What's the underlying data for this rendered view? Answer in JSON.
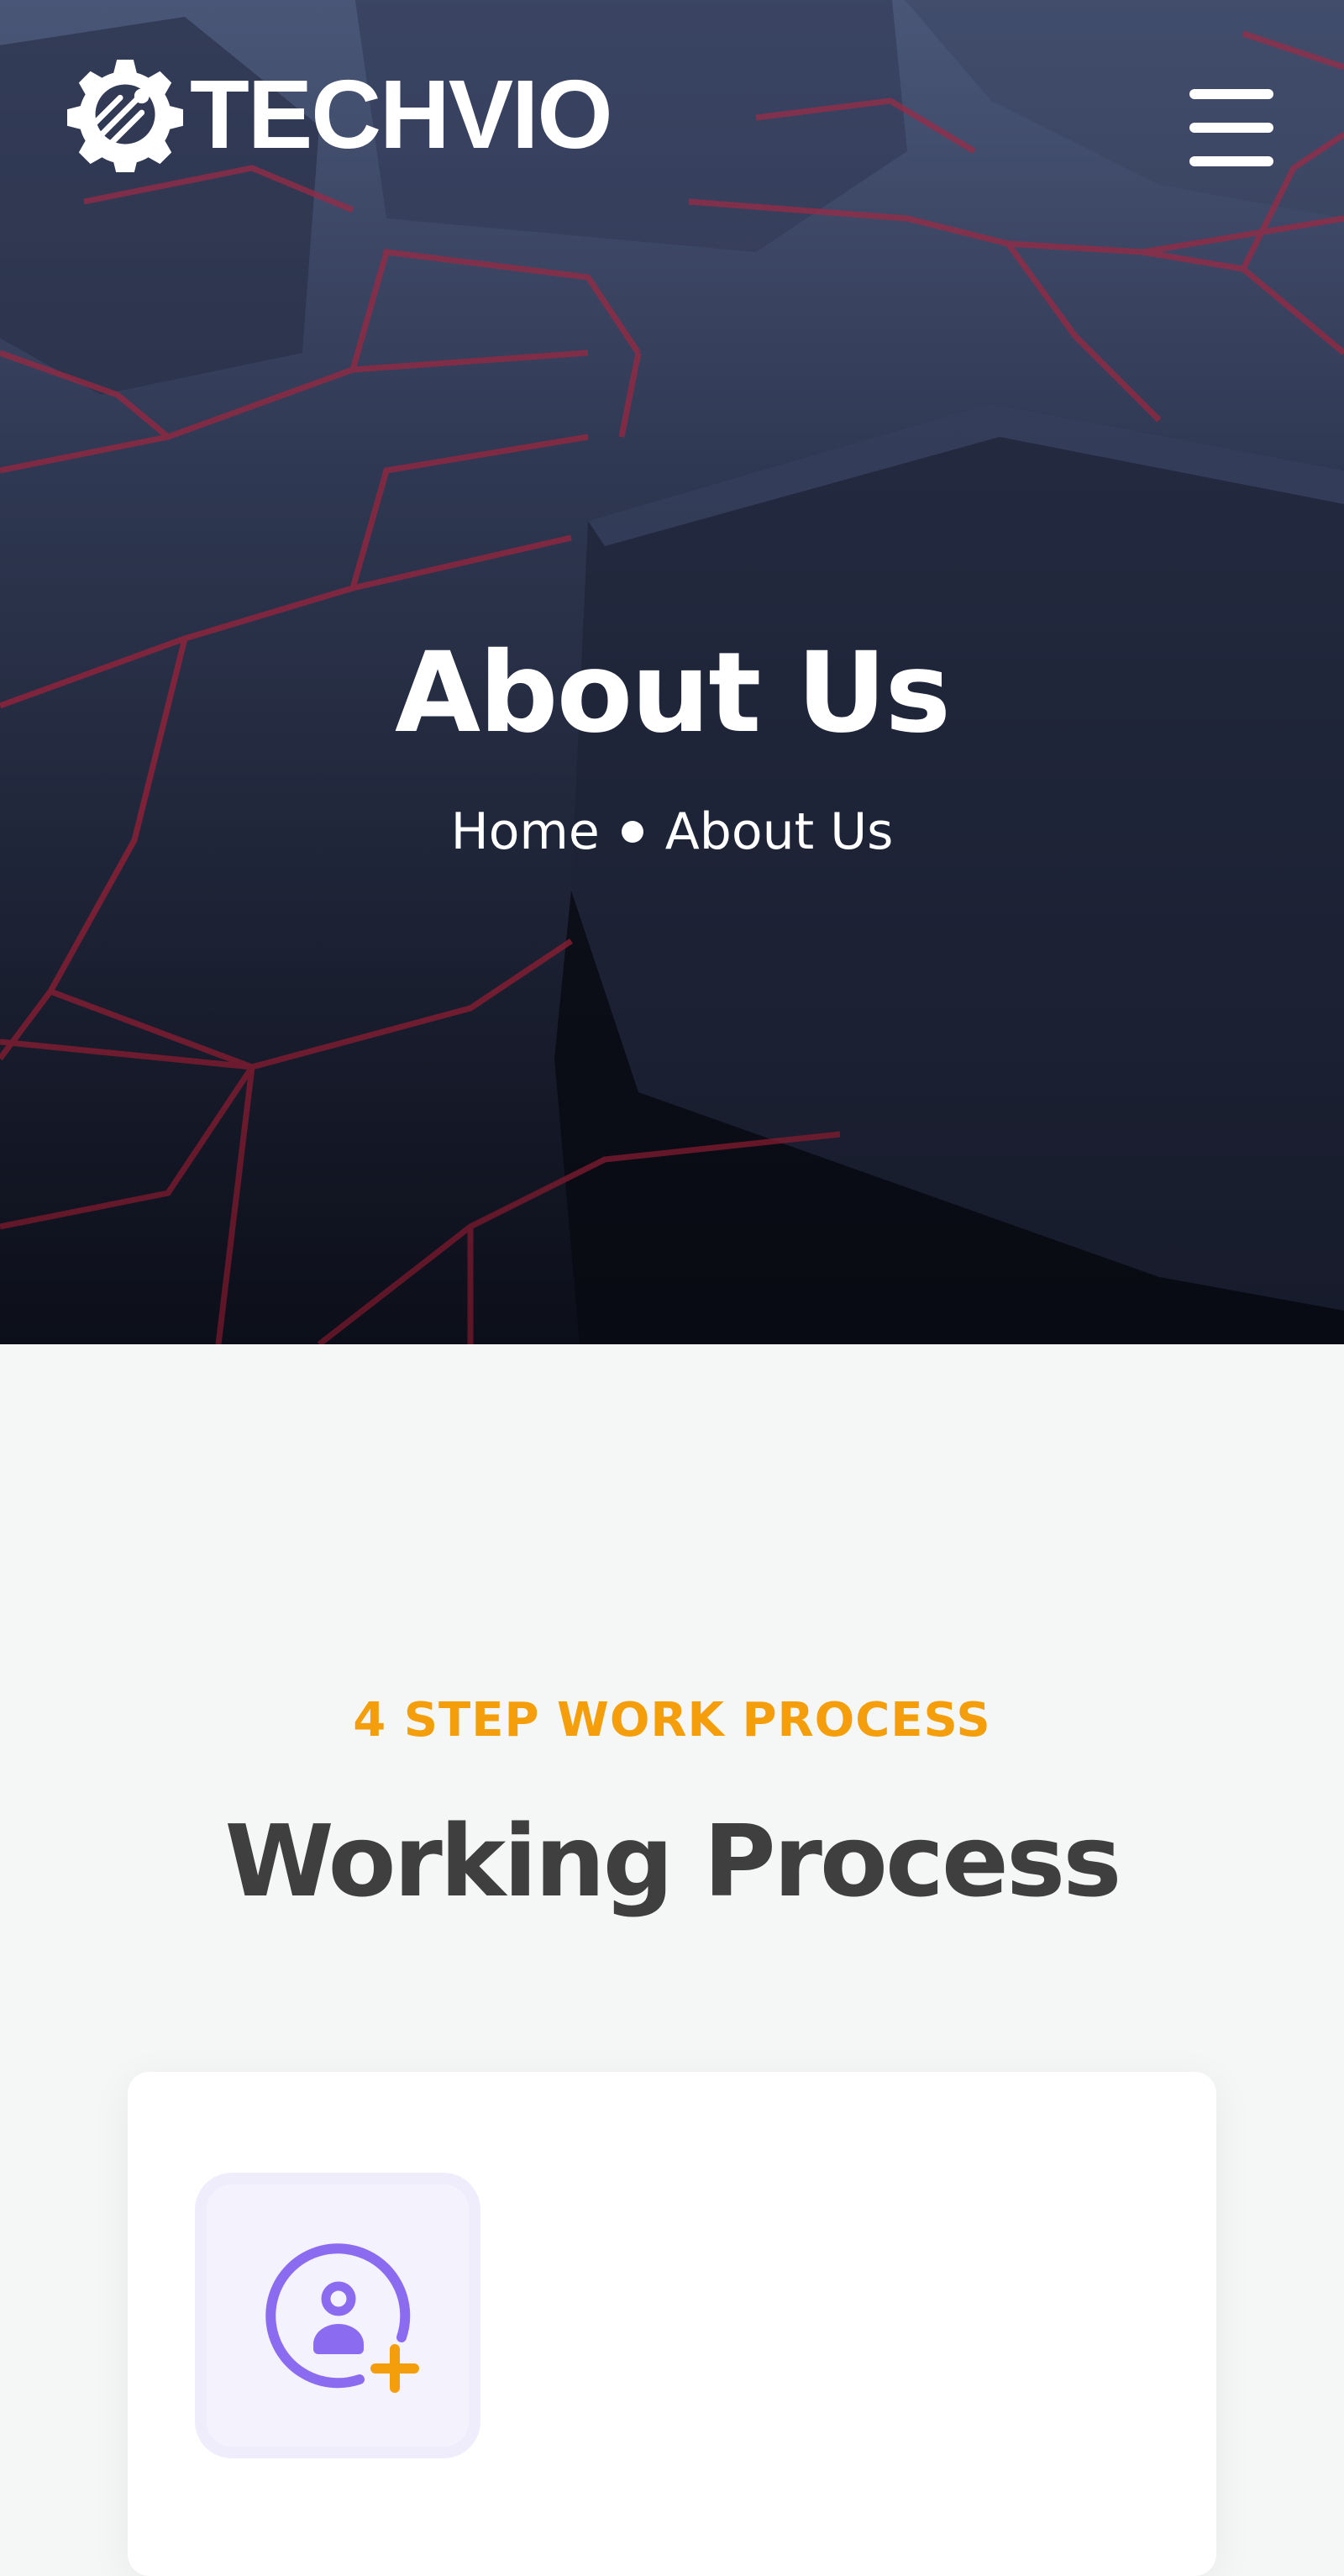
{
  "header": {
    "logo_text": "TECHVIO",
    "logo_icon": "gear-circuit-icon",
    "menu_icon": "hamburger-menu-icon"
  },
  "hero": {
    "title": "About Us",
    "breadcrumb": {
      "home": "Home",
      "current": "About Us"
    }
  },
  "process": {
    "subtitle": "4 STEP WORK PROCESS",
    "title": "Working Process",
    "steps": [
      {
        "icon": "add-user-icon"
      }
    ]
  },
  "colors": {
    "accent_orange": "#f59e0b",
    "accent_purple": "#8b6cf0",
    "heading": "#3f3f3f",
    "hero_lines": "#c0283a"
  }
}
